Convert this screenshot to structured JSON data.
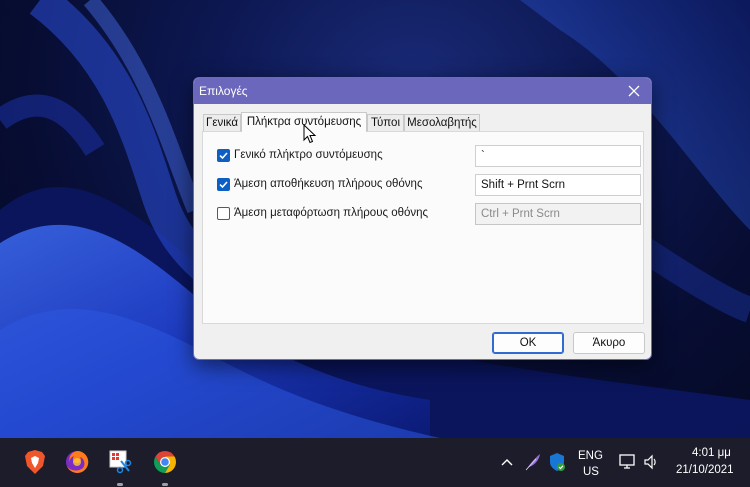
{
  "dialog": {
    "title": "Επιλογές",
    "tabs": [
      "Γενικά",
      "Πλήκτρα συντόμευσης",
      "Τύποι",
      "Μεσολαβητής"
    ],
    "active_tab": "Πλήκτρα συντόμευσης",
    "settings": [
      {
        "label": "Γενικό πλήκτρο συντόμευσης",
        "checked": true,
        "value": "`",
        "enabled": true
      },
      {
        "label": "Άμεση αποθήκευση πλήρους οθόνης",
        "checked": true,
        "value": "Shift + Prnt Scrn",
        "enabled": true
      },
      {
        "label": "Άμεση μεταφόρτωση πλήρους οθόνης",
        "checked": false,
        "value": "Ctrl + Prnt Scrn",
        "enabled": false
      }
    ],
    "ok_label": "OK",
    "cancel_label": "Άκυρο"
  },
  "taskbar": {
    "pinned_apps": [
      "brave-icon",
      "firefox-icon",
      "snipping-tool-icon",
      "chrome-icon"
    ],
    "language": "ENG",
    "layout": "US",
    "time": "4:01 μμ",
    "date": "21/10/2021"
  },
  "colors": {
    "titlebar": "#6b67bd",
    "checkbox": "#0e5fc4",
    "taskbar": "#1c1c2a"
  }
}
